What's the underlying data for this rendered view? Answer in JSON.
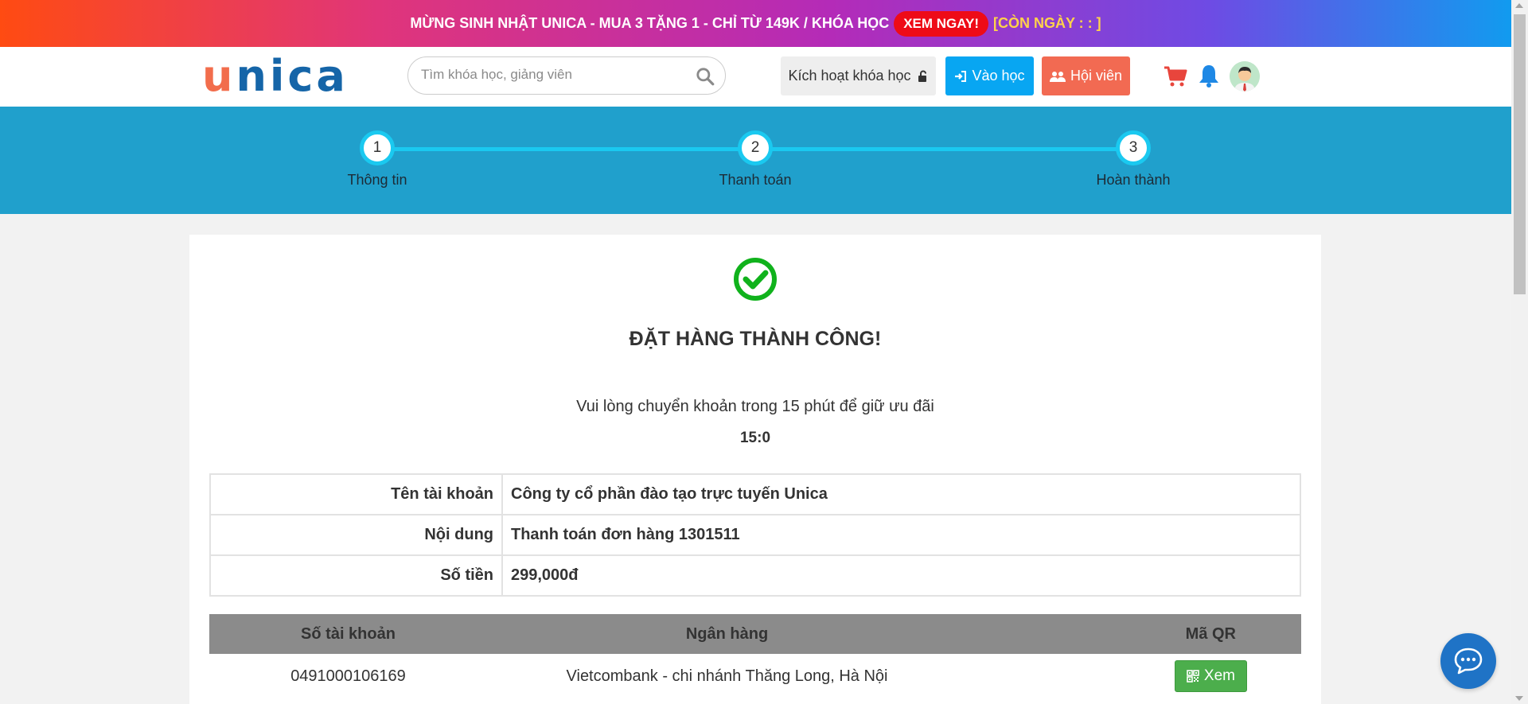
{
  "promo": {
    "text": "MỪNG SINH NHẬT UNICA - MUA 3 TẶNG 1 - CHỈ TỪ 149K / KHÓA HỌC",
    "cta": "XEM NGAY!",
    "countdown": "[CÒN NGÀY : : ]"
  },
  "header": {
    "logo_first": "u",
    "logo_rest": "nica",
    "search_placeholder": "Tìm khóa học, giảng viên",
    "activate_label": "Kích hoạt khóa học",
    "login_label": "Vào học",
    "member_label": "Hội viên"
  },
  "steps": [
    {
      "number": "1",
      "label": "Thông tin"
    },
    {
      "number": "2",
      "label": "Thanh toán"
    },
    {
      "number": "3",
      "label": "Hoàn thành"
    }
  ],
  "order": {
    "title": "ĐẶT HÀNG THÀNH CÔNG!",
    "notice": "Vui lòng chuyển khoản trong 15 phút để giữ ưu đãi",
    "timer": "15:0",
    "info": [
      {
        "key": "Tên tài khoản",
        "value": "Công ty cổ phần đào tạo trực tuyến Unica"
      },
      {
        "key": "Nội dung",
        "value": "Thanh toán đơn hàng 1301511"
      },
      {
        "key": "Số tiền",
        "value": "299,000đ"
      }
    ],
    "bank_headers": {
      "account": "Số tài khoản",
      "bank": "Ngân hàng",
      "qr": "Mã QR"
    },
    "bank_rows": [
      {
        "account": "0491000106169",
        "bank": "Vietcombank - chi nhánh Thăng Long, Hà Nội",
        "qr_label": "Xem"
      }
    ]
  },
  "colors": {
    "accent_blue": "#08a6f2",
    "member_orange": "#f26a52",
    "steps_bg": "#20a0cc",
    "success_green": "#10b21c"
  }
}
